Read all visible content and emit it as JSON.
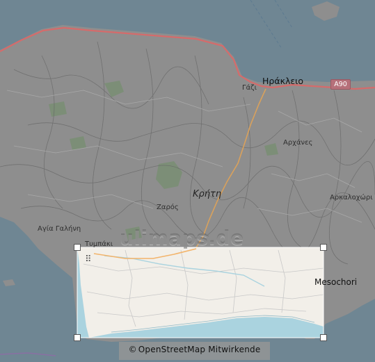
{
  "map": {
    "places": {
      "heraklion": "Ηράκλειο",
      "gazi": "Γάζι",
      "archanes": "Αρχάνες",
      "arkalochori": "Αρκαλοχώρι",
      "zaros": "Ζαρός",
      "agia_galini": "Αγία Γαλήνη",
      "tympaki": "Τυμπάκι",
      "mesochori": "Mesochori"
    },
    "region_label": "Κρήτη",
    "road_shield": "A90",
    "watermark": "ulimaps.de",
    "grip_icon": "⠿",
    "colors": {
      "sea": "#6f8693",
      "land_dimmed": "#8e8e8e",
      "land_selected": "#f2efe9",
      "sea_selected": "#aad3df",
      "motorway": "#e27d7d",
      "primary_road": "#f3b46b"
    }
  },
  "attribution": {
    "symbol": "©",
    "text": "OpenStreetMap Mitwirkende"
  }
}
